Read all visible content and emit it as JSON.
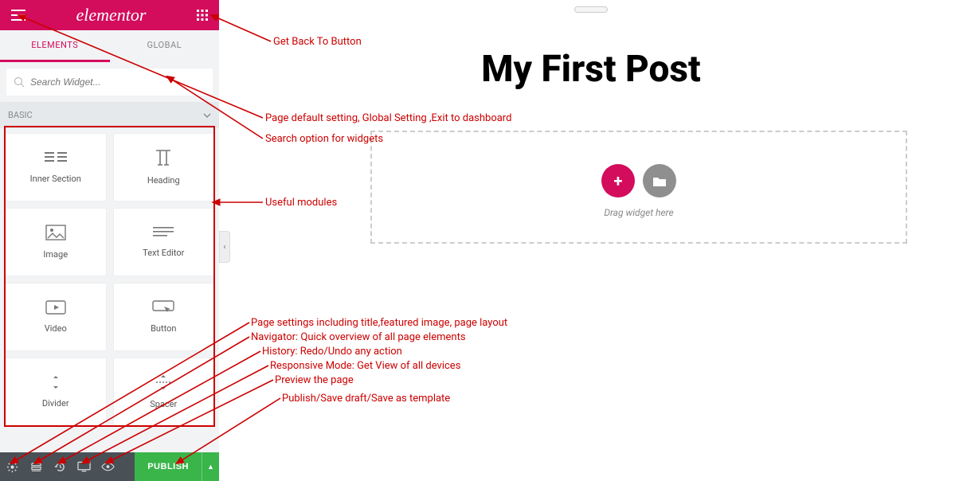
{
  "sidebar": {
    "logo": "elementor",
    "tabs": {
      "elements": "ELEMENTS",
      "global": "GLOBAL"
    },
    "search_placeholder": "Search Widget...",
    "section_head": "BASIC",
    "widgets": [
      {
        "label": "Inner Section"
      },
      {
        "label": "Heading"
      },
      {
        "label": "Image"
      },
      {
        "label": "Text Editor"
      },
      {
        "label": "Video"
      },
      {
        "label": "Button"
      },
      {
        "label": "Divider"
      },
      {
        "label": "Spacer"
      }
    ],
    "publish": "PUBLISH"
  },
  "canvas": {
    "title": "My First Post",
    "drop_text": "Drag widget here"
  },
  "annotations": {
    "a1": "Get Back To Button",
    "a2": "Page default setting, Global Setting ,Exit to dashboard",
    "a3": "Search option for widgets",
    "a4": "Useful modules",
    "a5": "Page settings including title,featured image, page layout",
    "a6": "Navigator: Quick overview of all page elements",
    "a7": "History: Redo/Undo any action",
    "a8": "Responsive Mode: Get View of all devices",
    "a9": "Preview the page",
    "a10": "Publish/Save draft/Save as template"
  }
}
